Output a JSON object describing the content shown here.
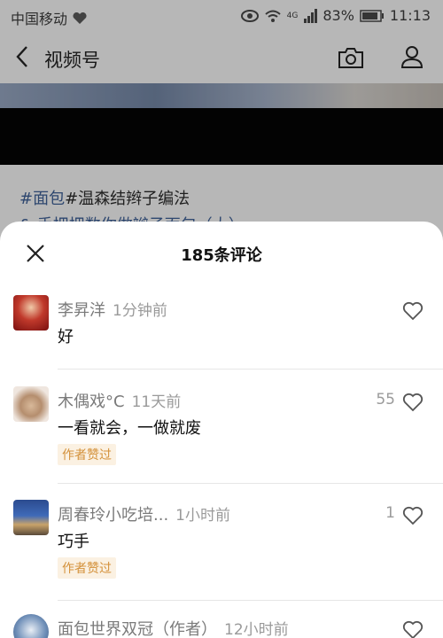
{
  "status_bar": {
    "carrier": "中国移动",
    "battery": "83%",
    "time": "11:13",
    "network": "4G"
  },
  "nav": {
    "title": "视频号",
    "back_icon": "chevron-left-icon",
    "camera_icon": "camera-icon",
    "profile_icon": "user-icon"
  },
  "post": {
    "tag1": "#面包",
    "tag2": "#温森结辫子编法",
    "description_peek": "& 手把把数你做辫子面包（大）"
  },
  "sheet": {
    "title": "185条评论",
    "close_icon": "close-icon"
  },
  "comments": [
    {
      "name": "李昇洋",
      "time": "1分钟前",
      "text": "好",
      "likes": "",
      "badge": ""
    },
    {
      "name": "木偶戏°C",
      "time": "11天前",
      "text": "一看就会，一做就废",
      "likes": "55",
      "badge": "作者赞过"
    },
    {
      "name": "周春玲小吃培...",
      "time": "1小时前",
      "text": "巧手",
      "likes": "1",
      "badge": "作者赞过"
    },
    {
      "name": "面包世界双冠（作者）",
      "time": "12小时前",
      "text": "",
      "likes": "",
      "badge": ""
    }
  ],
  "colors": {
    "tag": "#3b5b8f",
    "badge_text": "#d4913a",
    "badge_bg": "#fbf1e2"
  }
}
